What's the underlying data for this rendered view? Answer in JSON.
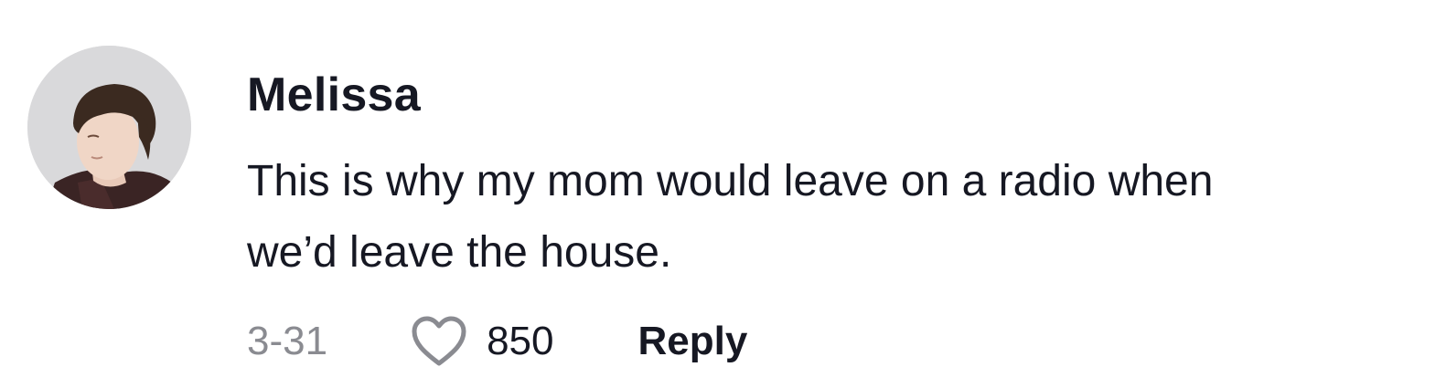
{
  "comment": {
    "username": "Melissa",
    "text_lines": [
      "This is why my mom would leave on a radio when",
      "we’d leave the house."
    ],
    "date": "3-31",
    "like_count": "850",
    "reply_label": "Reply",
    "avatar_icon": "user-avatar-photo",
    "like_icon": "heart-outline-icon"
  },
  "colors": {
    "text_primary": "#161823",
    "text_secondary": "#8a8b91",
    "heart_outline": "#8a8b91",
    "background": "#ffffff"
  }
}
